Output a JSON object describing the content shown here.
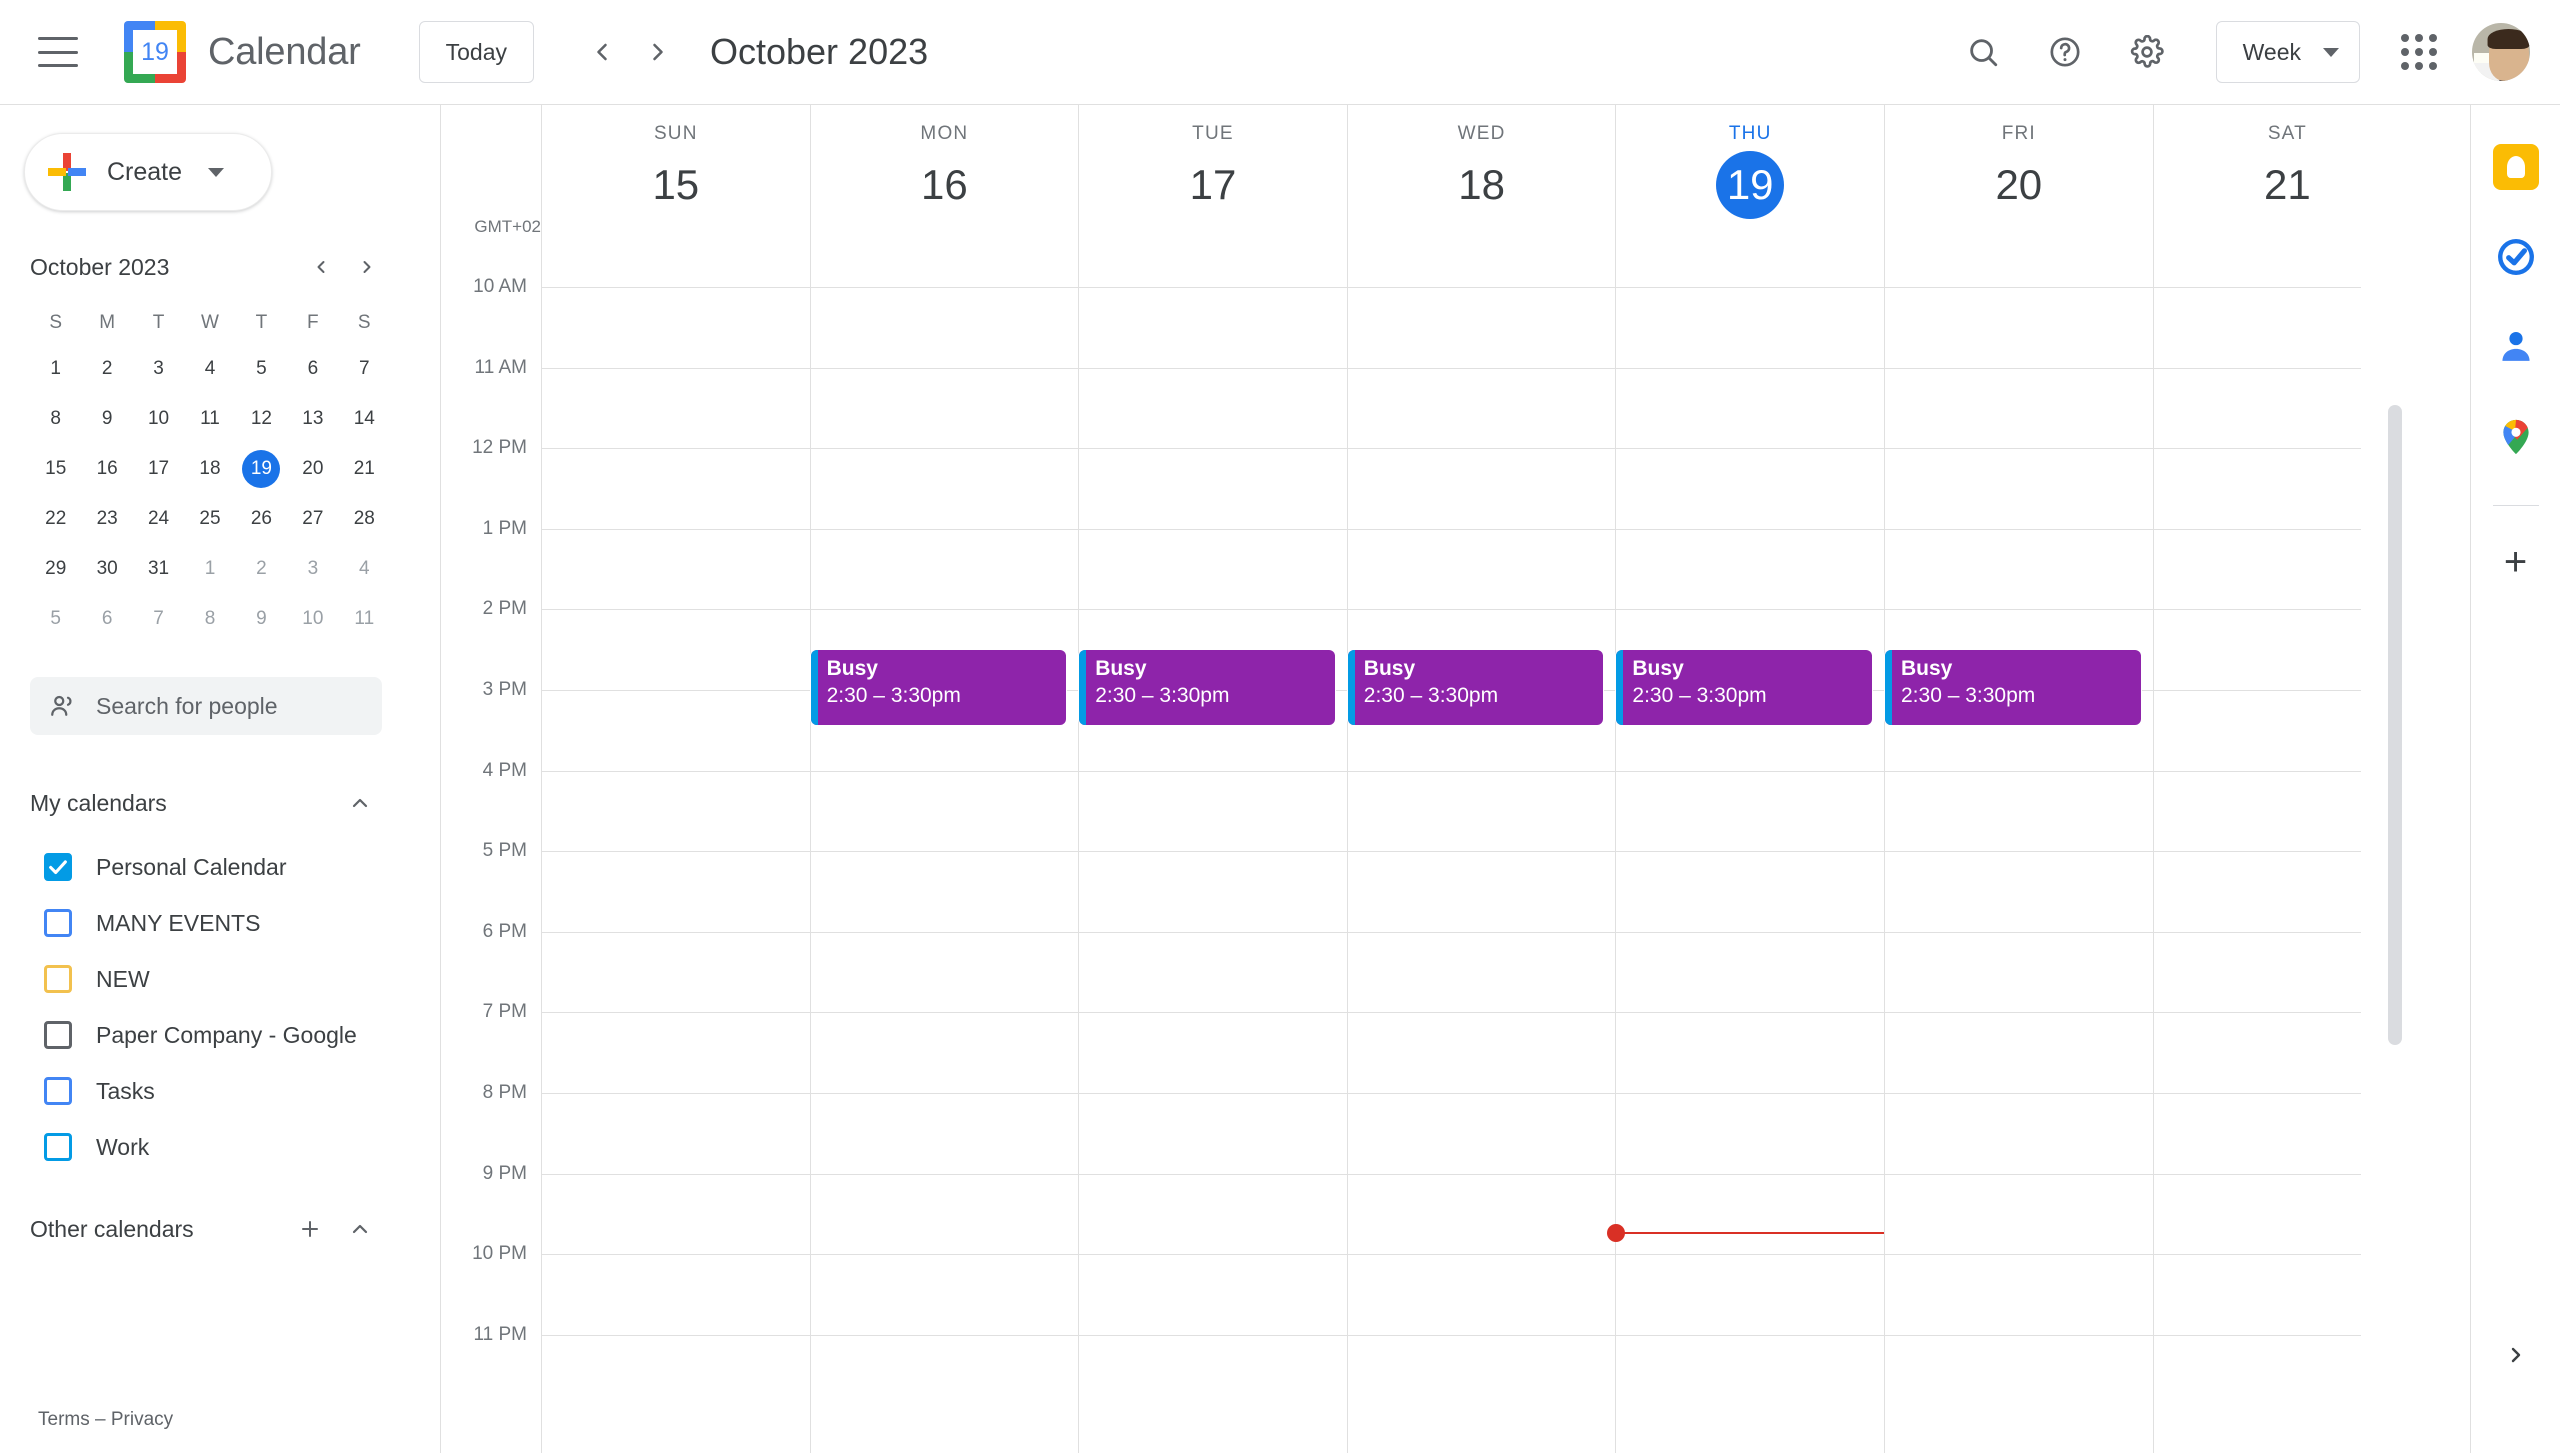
{
  "header": {
    "menu_icon": "hamburger-icon",
    "logo_day": "19",
    "app_title": "Calendar",
    "today_label": "Today",
    "prev_icon": "chevron-left-icon",
    "next_icon": "chevron-right-icon",
    "period_title": "October 2023",
    "search_icon": "search-icon",
    "help_icon": "help-icon",
    "settings_icon": "gear-icon",
    "view_label": "Week",
    "apps_icon": "apps-grid-icon",
    "avatar": "user-avatar"
  },
  "sidebar": {
    "create_label": "Create",
    "mini_calendar": {
      "title": "October 2023",
      "prev_icon": "chevron-left-icon",
      "next_icon": "chevron-right-icon",
      "dow": [
        "S",
        "M",
        "T",
        "W",
        "T",
        "F",
        "S"
      ],
      "weeks": [
        [
          {
            "d": "1"
          },
          {
            "d": "2"
          },
          {
            "d": "3"
          },
          {
            "d": "4"
          },
          {
            "d": "5"
          },
          {
            "d": "6"
          },
          {
            "d": "7"
          }
        ],
        [
          {
            "d": "8"
          },
          {
            "d": "9"
          },
          {
            "d": "10"
          },
          {
            "d": "11"
          },
          {
            "d": "12"
          },
          {
            "d": "13"
          },
          {
            "d": "14"
          }
        ],
        [
          {
            "d": "15"
          },
          {
            "d": "16"
          },
          {
            "d": "17"
          },
          {
            "d": "18"
          },
          {
            "d": "19",
            "today": true
          },
          {
            "d": "20"
          },
          {
            "d": "21"
          }
        ],
        [
          {
            "d": "22"
          },
          {
            "d": "23"
          },
          {
            "d": "24"
          },
          {
            "d": "25"
          },
          {
            "d": "26"
          },
          {
            "d": "27"
          },
          {
            "d": "28"
          }
        ],
        [
          {
            "d": "29"
          },
          {
            "d": "30"
          },
          {
            "d": "31"
          },
          {
            "d": "1",
            "muted": true
          },
          {
            "d": "2",
            "muted": true
          },
          {
            "d": "3",
            "muted": true
          },
          {
            "d": "4",
            "muted": true
          }
        ],
        [
          {
            "d": "5",
            "muted": true
          },
          {
            "d": "6",
            "muted": true
          },
          {
            "d": "7",
            "muted": true
          },
          {
            "d": "8",
            "muted": true
          },
          {
            "d": "9",
            "muted": true
          },
          {
            "d": "10",
            "muted": true
          },
          {
            "d": "11",
            "muted": true
          }
        ]
      ]
    },
    "search_people": {
      "icon": "people-icon",
      "placeholder": "Search for people"
    },
    "my_calendars": {
      "title": "My calendars",
      "collapse_icon": "chevron-up-icon",
      "items": [
        {
          "label": "Personal Calendar",
          "checked": true,
          "color": "#039be5"
        },
        {
          "label": "MANY EVENTS",
          "checked": false,
          "color": "#4285f4"
        },
        {
          "label": "NEW",
          "checked": false,
          "color": "#f2c14e"
        },
        {
          "label": "Paper Company - Google",
          "checked": false,
          "color": "#5f6368"
        },
        {
          "label": "Tasks",
          "checked": false,
          "color": "#4285f4"
        },
        {
          "label": "Work",
          "checked": false,
          "color": "#039be5"
        }
      ]
    },
    "other_calendars": {
      "title": "Other calendars",
      "add_icon": "plus-icon",
      "collapse_icon": "chevron-up-icon"
    },
    "footer": {
      "terms": "Terms",
      "separator": "–",
      "privacy": "Privacy"
    }
  },
  "calendar": {
    "timezone_label": "GMT+02",
    "days": [
      {
        "dow": "SUN",
        "num": "15",
        "today": false
      },
      {
        "dow": "MON",
        "num": "16",
        "today": false
      },
      {
        "dow": "TUE",
        "num": "17",
        "today": false
      },
      {
        "dow": "WED",
        "num": "18",
        "today": false
      },
      {
        "dow": "THU",
        "num": "19",
        "today": true
      },
      {
        "dow": "FRI",
        "num": "20",
        "today": false
      },
      {
        "dow": "SAT",
        "num": "21",
        "today": false
      }
    ],
    "hours": [
      "10 AM",
      "11 AM",
      "12 PM",
      "1 PM",
      "2 PM",
      "3 PM",
      "4 PM",
      "5 PM",
      "6 PM",
      "7 PM",
      "8 PM",
      "9 PM",
      "10 PM",
      "11 PM"
    ],
    "events": [
      {
        "day_index": 1,
        "title": "Busy",
        "time": "2:30 – 3:30pm",
        "color": "#8e24aa",
        "accent": "#039be5"
      },
      {
        "day_index": 2,
        "title": "Busy",
        "time": "2:30 – 3:30pm",
        "color": "#8e24aa",
        "accent": "#039be5"
      },
      {
        "day_index": 3,
        "title": "Busy",
        "time": "2:30 – 3:30pm",
        "color": "#8e24aa",
        "accent": "#039be5"
      },
      {
        "day_index": 4,
        "title": "Busy",
        "time": "2:30 – 3:30pm",
        "color": "#8e24aa",
        "accent": "#039be5"
      },
      {
        "day_index": 5,
        "title": "Busy",
        "time": "2:30 – 3:30pm",
        "color": "#8e24aa",
        "accent": "#039be5"
      }
    ],
    "current_time_indicator": {
      "day_index": 4,
      "color": "#d93025"
    }
  },
  "rail": {
    "icons": [
      "keep-icon",
      "tasks-icon",
      "contacts-icon",
      "maps-icon"
    ],
    "add_icon": "plus-icon",
    "expand_icon": "chevron-right-icon"
  }
}
